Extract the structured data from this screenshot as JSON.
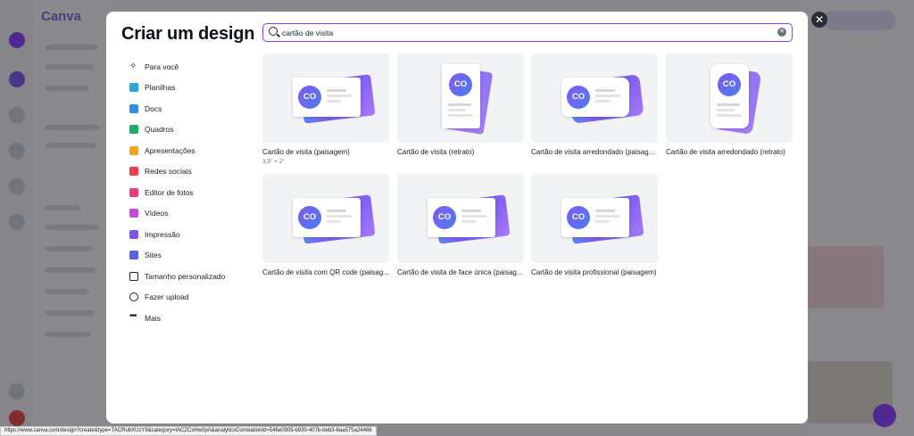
{
  "modal": {
    "title": "Criar um design",
    "close_label": "✕"
  },
  "search": {
    "value": "cartão de visita",
    "clear_label": "✕"
  },
  "categories": [
    {
      "label": "Para você",
      "icon": "sparkle-icon",
      "color": "#111111"
    },
    {
      "label": "Planilhas",
      "icon": "spreadsheet-icon",
      "color": "#2aa5d8"
    },
    {
      "label": "Docs",
      "icon": "docs-icon",
      "color": "#2d8fe6"
    },
    {
      "label": "Quadros",
      "icon": "whiteboard-icon",
      "color": "#1fae6a"
    },
    {
      "label": "Apresentações",
      "icon": "presentation-icon",
      "color": "#f2a21b"
    },
    {
      "label": "Redes sociais",
      "icon": "heart-icon",
      "color": "#ef3b4e"
    },
    {
      "label": "Editor de fotos",
      "icon": "camera-icon",
      "color": "#ec3b7d"
    },
    {
      "label": "Vídeos",
      "icon": "video-icon",
      "color": "#c54bdc"
    },
    {
      "label": "Impressão",
      "icon": "printer-icon",
      "color": "#7b57f0"
    },
    {
      "label": "Sites",
      "icon": "website-icon",
      "color": "#5b5ff0"
    },
    {
      "label": "Tamanho personalizado",
      "icon": "custom-size-icon",
      "color": "#222222"
    },
    {
      "label": "Fazer upload",
      "icon": "cloud-upload-icon",
      "color": "#222222"
    },
    {
      "label": "Mais",
      "icon": "more-icon",
      "color": "#222222"
    }
  ],
  "results": [
    {
      "label": "Cartão de visita (paisagem)",
      "sub": "3,5\" × 2\"",
      "art": "landscape"
    },
    {
      "label": "Cartão de visita (retrato)",
      "sub": "",
      "art": "portrait"
    },
    {
      "label": "Cartão de visita arredondado (paisage...",
      "sub": "",
      "art": "landscape-round"
    },
    {
      "label": "Cartão de visita arredondado (retrato)",
      "sub": "",
      "art": "portrait-round"
    },
    {
      "label": "Cartão de visita com QR code (paisag...",
      "sub": "",
      "art": "landscape"
    },
    {
      "label": "Cartão de visita de face única (paisag...",
      "sub": "",
      "art": "landscape"
    },
    {
      "label": "Cartão de visita profissional (paisagem)",
      "sub": "",
      "art": "landscape"
    }
  ],
  "thumb_logo_text": "CO",
  "status_url": "https://www.canva.com/design?create&type=TACRubXUzY8&category=tACZCsHw0pA&analyticsCorrelationId=546e0905-b930-407b-beb3-6aa575a24466",
  "background": {
    "logo": "Canva",
    "right_pill_color": "#dcd7f2",
    "fab_color": "#8b3dff"
  }
}
